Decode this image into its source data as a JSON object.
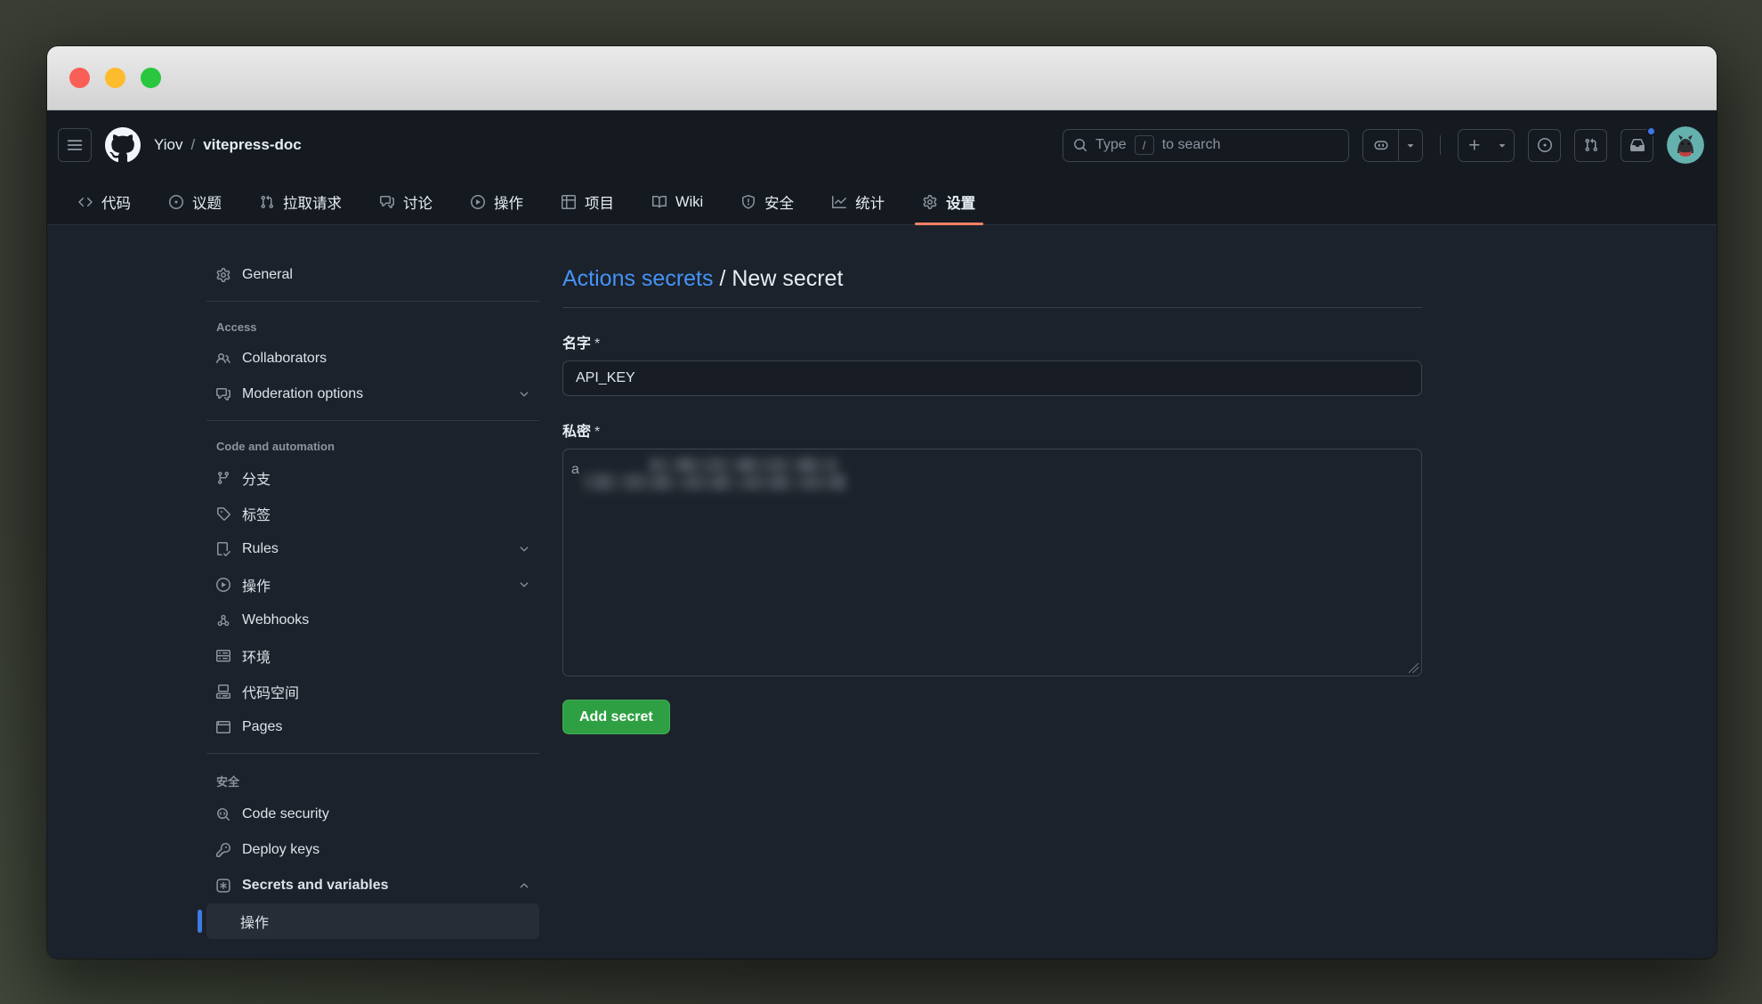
{
  "window": {
    "controls": [
      "close",
      "minimize",
      "zoom"
    ]
  },
  "header": {
    "breadcrumb": {
      "owner": "Yiov",
      "separator": "/",
      "repo": "vitepress-doc"
    },
    "search": {
      "prefix": "Type",
      "key": "/",
      "suffix": "to search"
    }
  },
  "repo_tabs": [
    {
      "key": "code",
      "icon": "code",
      "label": "代码"
    },
    {
      "key": "issues",
      "icon": "issue-opened",
      "label": "议题"
    },
    {
      "key": "pull-requests",
      "icon": "git-pull-request",
      "label": "拉取请求"
    },
    {
      "key": "discussions",
      "icon": "comment-discussion",
      "label": "讨论"
    },
    {
      "key": "actions",
      "icon": "play",
      "label": "操作"
    },
    {
      "key": "projects",
      "icon": "table",
      "label": "项目"
    },
    {
      "key": "wiki",
      "icon": "book",
      "label": "Wiki"
    },
    {
      "key": "security",
      "icon": "shield",
      "label": "安全"
    },
    {
      "key": "insights",
      "icon": "graph",
      "label": "统计"
    },
    {
      "key": "settings",
      "icon": "gear",
      "label": "设置",
      "active": true
    }
  ],
  "sidebar": {
    "groups": [
      {
        "items": [
          {
            "key": "general",
            "icon": "gear",
            "label": "General"
          }
        ]
      },
      {
        "title": "Access",
        "items": [
          {
            "key": "collaborators",
            "icon": "people",
            "label": "Collaborators"
          },
          {
            "key": "moderation-options",
            "icon": "comment-discussion",
            "label": "Moderation options",
            "chevron": "down"
          }
        ]
      },
      {
        "title": "Code and automation",
        "items": [
          {
            "key": "branches",
            "icon": "branch",
            "label": "分支"
          },
          {
            "key": "tags",
            "icon": "tag",
            "label": "标签"
          },
          {
            "key": "rules",
            "icon": "checklist",
            "label": "Rules",
            "chevron": "down"
          },
          {
            "key": "actions",
            "icon": "play",
            "label": "操作",
            "chevron": "down"
          },
          {
            "key": "webhooks",
            "icon": "webhook",
            "label": "Webhooks"
          },
          {
            "key": "environments",
            "icon": "server",
            "label": "环境"
          },
          {
            "key": "codespaces",
            "icon": "codespaces",
            "label": "代码空间"
          },
          {
            "key": "pages",
            "icon": "browser",
            "label": "Pages"
          }
        ]
      },
      {
        "title": "安全",
        "items": [
          {
            "key": "code-security",
            "icon": "codescan",
            "label": "Code security"
          },
          {
            "key": "deploy-keys",
            "icon": "key",
            "label": "Deploy keys"
          },
          {
            "key": "secrets-and-variables",
            "icon": "asterisk-box",
            "label": "Secrets and variables",
            "chevron": "up",
            "bold": true,
            "children": [
              {
                "key": "actions-secrets",
                "label": "操作",
                "active": true
              }
            ]
          }
        ]
      }
    ]
  },
  "main": {
    "breadcrumb_link": "Actions secrets",
    "breadcrumb_separator": "/",
    "breadcrumb_current": "New secret",
    "name_label": "名字",
    "required_mark": "*",
    "name_value": "API_KEY",
    "secret_label": "私密",
    "secret_visible_char": "a",
    "secret_value_obscured": true,
    "add_button_label": "Add secret"
  },
  "colors": {
    "accent_link": "#4493f8",
    "tab_underline": "#f78166",
    "primary_button": "#2ea043",
    "active_item_bar": "#3c7ce0",
    "notification_dot": "#3c79e6",
    "traffic_lights": [
      "#f95f56",
      "#fdbc2e",
      "#29c63f"
    ],
    "header_bg": "#151a21",
    "content_bg": "#1c222b",
    "border": "#3d444d"
  }
}
